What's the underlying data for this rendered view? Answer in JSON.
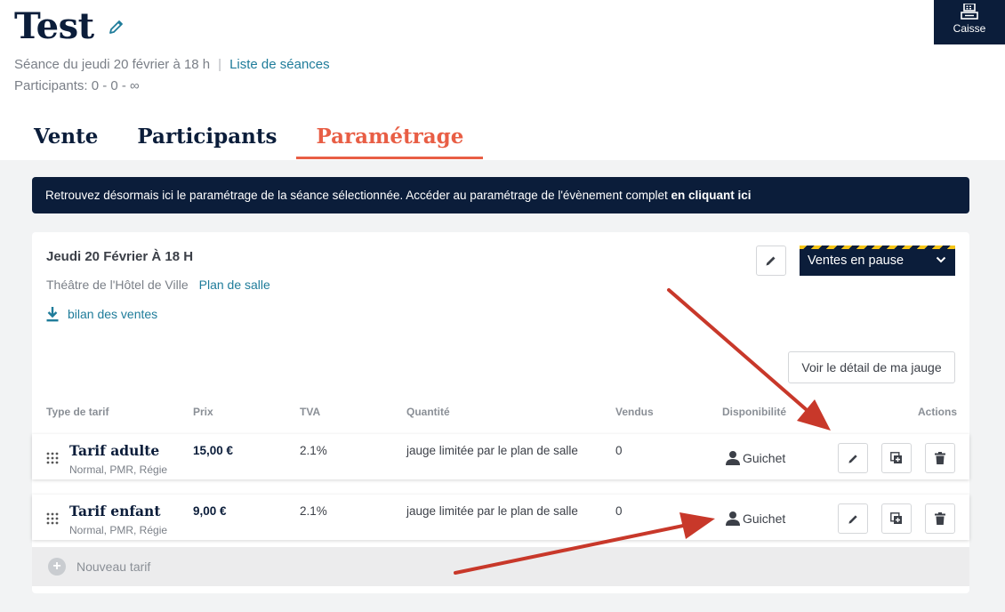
{
  "header": {
    "title": "Test",
    "seance_label": "Séance du jeudi 20 février à 18 h",
    "separator": "|",
    "seances_link": "Liste de séances",
    "participants": "Participants:  0 - 0 - ∞"
  },
  "caisse": {
    "label": "Caisse",
    "icon": "cash-register-icon"
  },
  "tabs": [
    {
      "label": "Vente",
      "active": false
    },
    {
      "label": "Participants",
      "active": false
    },
    {
      "label": "Paramétrage",
      "active": true
    }
  ],
  "banner": {
    "text": "Retrouvez désormais ici le paramétrage de la séance sélectionnée. Accéder au paramétrage de l'évènement complet ",
    "link": "en cliquant ici"
  },
  "seance": {
    "title": "Jeudi 20 Février À 18 H",
    "venue": "Théâtre de l'Hôtel de Ville",
    "plan_link": "Plan de salle",
    "bilan_link": "bilan des ventes",
    "status": "Ventes en pause",
    "gauge_button": "Voir le détail de ma jauge"
  },
  "table": {
    "headers": {
      "type": "Type de tarif",
      "prix": "Prix",
      "tva": "TVA",
      "quantite": "Quantité",
      "vendus": "Vendus",
      "dispo": "Disponibilité",
      "actions": "Actions"
    },
    "rows": [
      {
        "name": "Tarif adulte",
        "sub": "Normal, PMR, Régie",
        "prix": "15,00 €",
        "tva": "2.1%",
        "quantite": "jauge limitée par le plan de salle",
        "vendus": "0",
        "dispo": "Guichet"
      },
      {
        "name": "Tarif enfant",
        "sub": "Normal, PMR, Régie",
        "prix": "9,00 €",
        "tva": "2.1%",
        "quantite": "jauge limitée par le plan de salle",
        "vendus": "0",
        "dispo": "Guichet"
      }
    ],
    "new_tarif": "Nouveau tarif"
  },
  "colors": {
    "navy": "#0b1d3a",
    "accent": "#e85e45",
    "link": "#1f7c9a",
    "annotation_arrow": "#c8382a",
    "pause_stripes": "#f5c518"
  }
}
